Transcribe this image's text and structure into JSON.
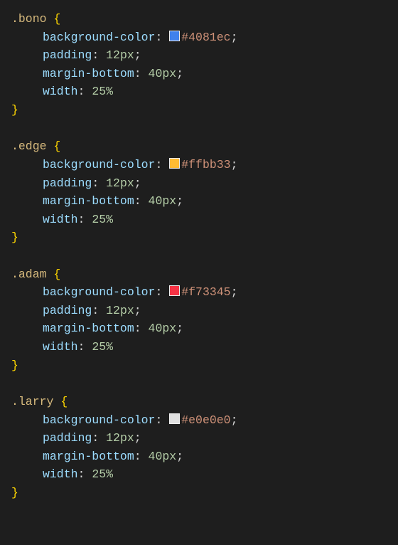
{
  "rules": [
    {
      "selector": ".bono",
      "decls": [
        {
          "prop": "background-color",
          "value": "#4081ec",
          "swatch": "#4081ec",
          "semi": true
        },
        {
          "prop": "padding",
          "value": "12px",
          "semi": true
        },
        {
          "prop": "margin-bottom",
          "value": "40px",
          "semi": true
        },
        {
          "prop": "width",
          "value": "25%",
          "semi": false
        }
      ]
    },
    {
      "selector": ".edge",
      "decls": [
        {
          "prop": "background-color",
          "value": "#ffbb33",
          "swatch": "#ffbb33",
          "semi": true
        },
        {
          "prop": "padding",
          "value": "12px",
          "semi": true
        },
        {
          "prop": "margin-bottom",
          "value": "40px",
          "semi": true
        },
        {
          "prop": "width",
          "value": "25%",
          "semi": false
        }
      ]
    },
    {
      "selector": ".adam",
      "decls": [
        {
          "prop": "background-color",
          "value": "#f73345",
          "swatch": "#f73345",
          "semi": true
        },
        {
          "prop": "padding",
          "value": "12px",
          "semi": true
        },
        {
          "prop": "margin-bottom",
          "value": "40px",
          "semi": true
        },
        {
          "prop": "width",
          "value": "25%",
          "semi": false
        }
      ]
    },
    {
      "selector": ".larry",
      "decls": [
        {
          "prop": "background-color",
          "value": "#e0e0e0",
          "swatch": "#e0e0e0",
          "semi": true
        },
        {
          "prop": "padding",
          "value": "12px",
          "semi": true
        },
        {
          "prop": "margin-bottom",
          "value": "40px",
          "semi": true
        },
        {
          "prop": "width",
          "value": "25%",
          "semi": false
        }
      ]
    }
  ]
}
